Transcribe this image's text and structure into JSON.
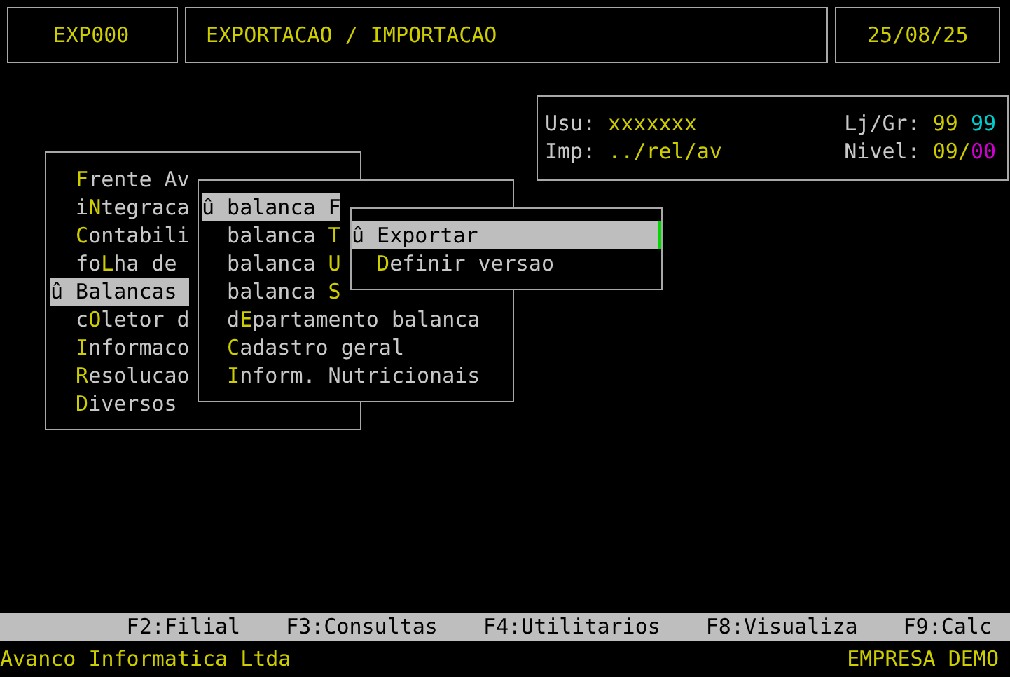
{
  "header": {
    "program_code": "EXP000",
    "title": "EXPORTACAO / IMPORTACAO",
    "date": "25/08/25"
  },
  "info": {
    "rows": [
      {
        "label": "Usu:",
        "value": "xxxxxxx",
        "right_label": "Lj/Gr:",
        "right_values": [
          {
            "text": "99",
            "color": "#cdcd00"
          },
          {
            "text": "99",
            "color": "#00cdcd"
          }
        ]
      },
      {
        "label": "Imp:",
        "value": "../rel/av",
        "right_label": "Nivel:",
        "separator": "/",
        "right_values": [
          {
            "text": "09",
            "color": "#cdcd00"
          },
          {
            "text": "00",
            "color": "#cd00cd"
          }
        ]
      }
    ]
  },
  "menus": [
    {
      "cursor": "û",
      "text_cursor": false,
      "items": [
        {
          "key": "F",
          "after": "rente Av",
          "selected": false
        },
        {
          "before": "i",
          "key": "N",
          "after": "tegraca",
          "selected": false
        },
        {
          "key": "C",
          "after": "ontabili",
          "selected": false
        },
        {
          "before": "fo",
          "key": "L",
          "after": "ha de",
          "selected": false
        },
        {
          "key": "B",
          "after": "alancas",
          "selected": true
        },
        {
          "before": "c",
          "key": "O",
          "after": "letor d",
          "selected": false
        },
        {
          "key": "I",
          "after": "nformaco",
          "selected": false
        },
        {
          "key": "R",
          "after": "esolucao",
          "selected": false
        },
        {
          "key": "D",
          "after": "iversos",
          "selected": false
        }
      ]
    },
    {
      "cursor": "û",
      "text_cursor": false,
      "items": [
        {
          "before": "balanca ",
          "key": "F",
          "selected": true
        },
        {
          "before": "balanca ",
          "key": "T",
          "selected": false
        },
        {
          "before": "balanca ",
          "key": "U",
          "selected": false
        },
        {
          "before": "balanca ",
          "key": "S",
          "selected": false
        },
        {
          "before": "d",
          "key": "E",
          "after": "partamento balanca",
          "selected": false
        },
        {
          "key": "C",
          "after": "adastro geral",
          "selected": false
        },
        {
          "key": "I",
          "after": "nform. Nutricionais",
          "selected": false
        }
      ]
    },
    {
      "cursor": "û",
      "text_cursor": true,
      "items": [
        {
          "key": "E",
          "after": "xportar",
          "selected": true
        },
        {
          "key": "D",
          "after": "efinir versao",
          "selected": false
        }
      ]
    }
  ],
  "function_keys": [
    "F2:Filial",
    "F3:Consultas",
    "F4:Utilitarios",
    "F8:Visualiza",
    "F9:Calc"
  ],
  "footer": {
    "company": "Avanco Informatica Ltda",
    "client": "EMPRESA DEMO"
  }
}
